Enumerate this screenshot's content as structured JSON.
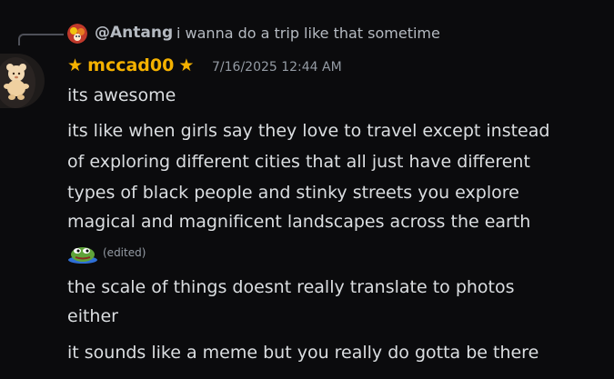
{
  "reply": {
    "author": "@Antang",
    "text": "i wanna do a trip like that sometime"
  },
  "message": {
    "star_left": "★",
    "author": "mccad00",
    "star_right": "★",
    "timestamp": "7/16/2025 12:44 AM",
    "paragraphs": [
      {
        "lines": [
          "its awesome"
        ]
      },
      {
        "lines": [
          "its like when girls say they love to travel except instead",
          "of exploring different cities that all just have different",
          "types of black people and stinky streets you explore",
          "magical and magnificent landscapes across the earth"
        ]
      },
      {
        "lines": [
          "the scale of things doesnt really translate to photos",
          "either"
        ]
      },
      {
        "lines": [
          "it sounds like a meme but you really do gotta be there"
        ]
      }
    ],
    "emoji_name": "pepe-frog-emoji",
    "edited_label": "(edited)"
  },
  "colors": {
    "background": "#0b0b0d",
    "author_color": "#f4b100",
    "text_color": "#dbdee1",
    "muted": "#949ba4"
  }
}
